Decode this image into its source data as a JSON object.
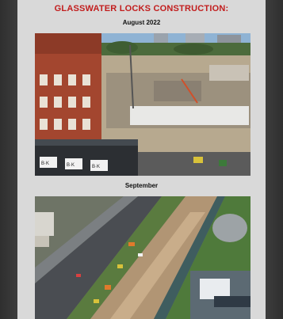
{
  "document": {
    "title": "GLASSWATER LOCKS CONSTRUCTION:",
    "sections": [
      {
        "month_label": "August 2022",
        "photo": {
          "icon": "aerial-construction-photo-august",
          "alt": "Aerial photo of the construction site with a red brick building on the left and site cabins"
        },
        "cabin_signs": [
          "B·K",
          "B·K",
          "B·K"
        ]
      },
      {
        "month_label": "September",
        "photo": {
          "icon": "aerial-construction-photo-september",
          "alt": "Top-down aerial photo of the construction site beside a road and canal"
        }
      }
    ]
  }
}
